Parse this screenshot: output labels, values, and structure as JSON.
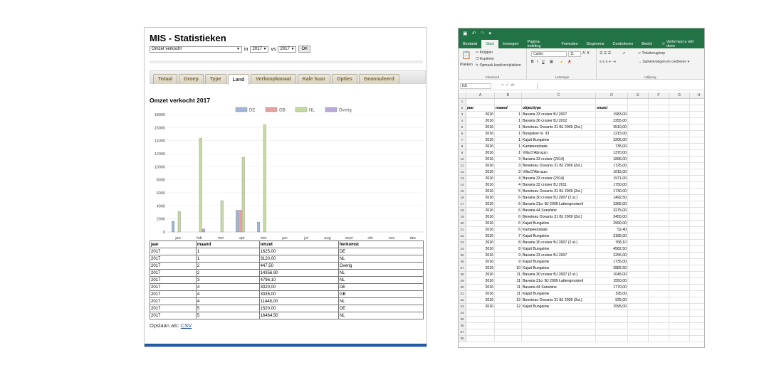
{
  "mis": {
    "title": "MIS - Statistieken",
    "metric_select": "Omzet verkocht",
    "in_label": "in",
    "year_a": "2017",
    "vs_label": "vs",
    "year_b": "2017",
    "ok_label": "OK",
    "tabs": [
      {
        "label": "Totaal"
      },
      {
        "label": "Groep"
      },
      {
        "label": "Type"
      },
      {
        "label": "Land"
      },
      {
        "label": "Verkoopkanaal"
      },
      {
        "label": "Kale huur"
      },
      {
        "label": "Opties"
      },
      {
        "label": "Geannuleerd"
      }
    ],
    "active_tab": "Land",
    "table": {
      "headers": [
        "jaar",
        "maand",
        "omzet",
        "herkomst"
      ],
      "rows": [
        [
          "2017",
          "1",
          "1625,00",
          "DE"
        ],
        [
          "2017",
          "1",
          "3120,00",
          "NL"
        ],
        [
          "2017",
          "2",
          "447,50",
          "Overig"
        ],
        [
          "2017",
          "2",
          "14356,90",
          "NL"
        ],
        [
          "2017",
          "3",
          "4796,10",
          "NL"
        ],
        [
          "2017",
          "4",
          "3320,00",
          "DE"
        ],
        [
          "2017",
          "4",
          "3335,00",
          "GB"
        ],
        [
          "2017",
          "4",
          "11448,00",
          "NL"
        ],
        [
          "2017",
          "5",
          "1520,00",
          "DE"
        ],
        [
          "2017",
          "5",
          "16464,50",
          "NL"
        ]
      ]
    },
    "save_label": "Opslaan als:",
    "save_link": "CSV"
  },
  "chart_data": {
    "type": "bar",
    "title": "Omzet verkocht 2017",
    "categories": [
      "jan",
      "feb",
      "mrt",
      "apr",
      "mei",
      "jun",
      "jul",
      "aug",
      "sept",
      "okt",
      "nov",
      "dec"
    ],
    "series": [
      {
        "name": "DE",
        "color": "#9fb6d8",
        "values": [
          1625,
          0,
          0,
          3320,
          1520,
          0,
          0,
          0,
          0,
          0,
          0,
          0
        ]
      },
      {
        "name": "GB",
        "color": "#e2a3a3",
        "values": [
          0,
          0,
          0,
          3335,
          0,
          0,
          0,
          0,
          0,
          0,
          0,
          0
        ]
      },
      {
        "name": "NL",
        "color": "#c6dba1",
        "values": [
          3120,
          14356.9,
          4796.1,
          11448,
          16464.5,
          0,
          0,
          0,
          0,
          0,
          0,
          0
        ]
      },
      {
        "name": "Overig",
        "color": "#b8a9d6",
        "values": [
          0,
          447.5,
          0,
          0,
          0,
          0,
          0,
          0,
          0,
          0,
          0,
          0
        ]
      }
    ],
    "yticks": [
      "0",
      "2000",
      "4000",
      "6000",
      "8000",
      "10000",
      "12000",
      "14000",
      "16000",
      "18000"
    ],
    "ylim": [
      0,
      18000
    ],
    "grid": true,
    "legend": "top-center"
  },
  "excel": {
    "tabs": [
      "Bestand",
      "Start",
      "Invoegen",
      "Pagina-indeling",
      "Formules",
      "Gegevens",
      "Controleren",
      "Beeld"
    ],
    "active_tab": "Start",
    "tell_me": "Vertel wat u wilt doen",
    "ribbon": {
      "paste": "Plakken",
      "cut": "Knippen",
      "copy": "Kopiëren",
      "format_painter": "Opmaak kopiëren/plakken",
      "clipboard": "Klembord",
      "font_name": "Calibri",
      "font_size": "11",
      "font_group": "Lettertype",
      "wrap_text": "Tekstterugloop",
      "merge_center": "Samenvoegen en centreren",
      "alignment_group": "Uitlijning"
    },
    "name_box": "I16",
    "columns": [
      "A",
      "B",
      "C",
      "D",
      "E",
      "F",
      "G",
      "H"
    ],
    "header_row": [
      "jaar",
      "maand",
      "objecttype",
      "omzet"
    ],
    "rows": [
      [
        "2016",
        "1",
        "Bavaria 33 cruiser BJ 2007",
        "1983,00"
      ],
      [
        "2016",
        "1",
        "Bavaria 36 cruiser BJ 2012",
        "2255,00"
      ],
      [
        "2016",
        "1",
        "Beneteau Oceanis 31 BJ 2009 (2st.)",
        "3510,00"
      ],
      [
        "2016",
        "1",
        "Bungalow nr. 33",
        "1215,00"
      ],
      [
        "2016",
        "1",
        "Kajuit Bungalow",
        "3206,00"
      ],
      [
        "2016",
        "1",
        "Kampeerplaats",
        "735,00"
      ],
      [
        "2016",
        "1",
        "Villa D'Abruzzo",
        "1370,00"
      ],
      [
        "2016",
        "3",
        "Bavaria  33 cruiser (2014)",
        "1896,00"
      ],
      [
        "2016",
        "3",
        "Beneteau Oceanis 31 BJ 2009 (2st.)",
        "1725,00"
      ],
      [
        "2016",
        "3",
        "Villa D'Abruzzo",
        "1615,00"
      ],
      [
        "2016",
        "4",
        "Bavaria  33 cruiser (2014)",
        "1971,00"
      ],
      [
        "2016",
        "4",
        "Bavaria 32 cruiser BJ 2011",
        "1750,00"
      ],
      [
        "2016",
        "5",
        "Beneteau Oceanis 31 BJ 2009 (2st.)",
        "1730,00"
      ],
      [
        "2016",
        "6",
        "Bavaria 30 cruiser BJ 2007 (2 st.)",
        "1492,50"
      ],
      [
        "2016",
        "6",
        "Bavaria 31cr BJ 2009 Lattengrootzeil",
        "3365,00"
      ],
      [
        "2016",
        "6",
        "Bavaria 44 Sunshine",
        "3275,00"
      ],
      [
        "2016",
        "6",
        "Beneteau Oceanis 31 BJ 2009 (2st.)",
        "3455,00"
      ],
      [
        "2016",
        "6",
        "Kajuit Bungalow",
        "2990,00"
      ],
      [
        "2016",
        "6",
        "Kampeerplaats",
        "52,40"
      ],
      [
        "2016",
        "7",
        "Kajuit Bungalow",
        "3185,00"
      ],
      [
        "2016",
        "8",
        "Bavaria 30 cruiser BJ 2007 (2 st.)",
        "768,10"
      ],
      [
        "2016",
        "8",
        "Kajuit Bungalow",
        "4582,50"
      ],
      [
        "2016",
        "9",
        "Bavaria 33 cruiser BJ 2007",
        "2255,00"
      ],
      [
        "2016",
        "9",
        "Kajuit Bungalow",
        "1735,00"
      ],
      [
        "2016",
        "10",
        "Kajuit Bungalow",
        "2882,50"
      ],
      [
        "2016",
        "11",
        "Bavaria 30 cruiser BJ 2007 (2 st.)",
        "1045,00"
      ],
      [
        "2016",
        "11",
        "Bavaria 31cr BJ 2009 Lattengrootzeil",
        "1550,00"
      ],
      [
        "2016",
        "11",
        "Bavaria 44 Sunshine",
        "1770,00"
      ],
      [
        "2016",
        "11",
        "Kajuit Bungalow",
        "195,00"
      ],
      [
        "2016",
        "12",
        "Beneteau Oceanis 31 BJ 2009 (2st.)",
        "925,00"
      ],
      [
        "2016",
        "12",
        "Kajuit Bungalow",
        "1595,00"
      ]
    ],
    "row_count": 38
  }
}
